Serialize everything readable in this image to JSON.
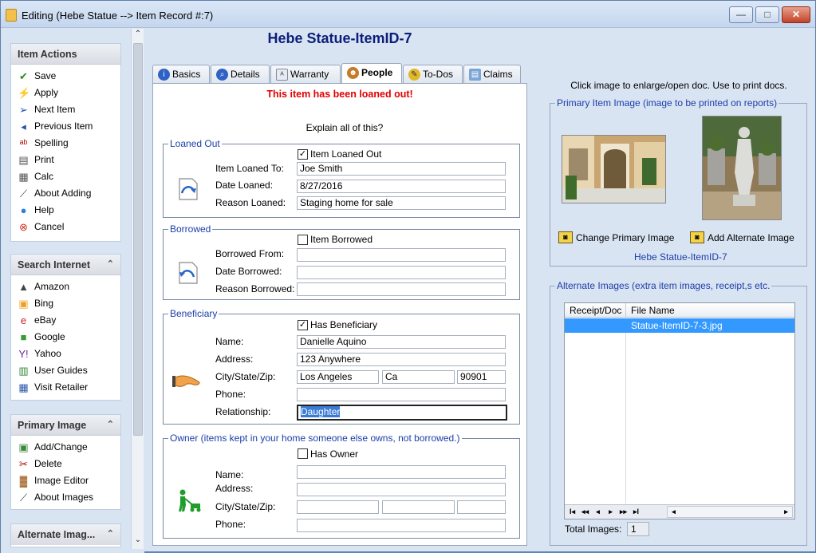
{
  "window": {
    "title": "Editing  (Hebe Statue --> Item Record #:7)",
    "minimize": "—",
    "maximize": "□",
    "close": "✕"
  },
  "sidebar": {
    "item_actions": {
      "header": "Item Actions",
      "items": [
        {
          "label": "Save",
          "icon": "check-icon",
          "glyph": "✔",
          "color": "#2a8a1a"
        },
        {
          "label": "Apply",
          "icon": "apply-icon",
          "glyph": "⚡",
          "color": "#d08a00"
        },
        {
          "label": "Next Item",
          "icon": "next-icon",
          "glyph": "➢",
          "color": "#2855a8"
        },
        {
          "label": "Previous Item",
          "icon": "previous-icon",
          "glyph": "◂",
          "color": "#2855a8"
        },
        {
          "label": "Spelling",
          "icon": "spelling-icon",
          "glyph": "ᵃᵇ",
          "color": "#b00000"
        },
        {
          "label": "Print",
          "icon": "printer-icon",
          "glyph": "▤",
          "color": "#555"
        },
        {
          "label": "Calc",
          "icon": "calculator-icon",
          "glyph": "▦",
          "color": "#555"
        },
        {
          "label": "About Adding",
          "icon": "wand-icon",
          "glyph": "⟋",
          "color": "#444"
        },
        {
          "label": "Help",
          "icon": "help-icon",
          "glyph": "●",
          "color": "#2f7fd8"
        },
        {
          "label": "Cancel",
          "icon": "cancel-icon",
          "glyph": "⊗",
          "color": "#d62d20"
        }
      ]
    },
    "search_internet": {
      "header": "Search Internet",
      "collapse": "⌃",
      "items": [
        {
          "label": "Amazon",
          "icon": "amazon-icon",
          "glyph": "▲",
          "color": "#444"
        },
        {
          "label": "Bing",
          "icon": "bing-icon",
          "glyph": "▣",
          "color": "#f0a020"
        },
        {
          "label": "eBay",
          "icon": "ebay-icon",
          "glyph": "e",
          "color": "#c0232c"
        },
        {
          "label": "Google",
          "icon": "google-icon",
          "glyph": "■",
          "color": "#3a9a3a"
        },
        {
          "label": "Yahoo",
          "icon": "yahoo-icon",
          "glyph": "Y!",
          "color": "#6b1fa8"
        },
        {
          "label": "User Guides",
          "icon": "guides-icon",
          "glyph": "▥",
          "color": "#3a8a3a"
        },
        {
          "label": "Visit Retailer",
          "icon": "retailer-icon",
          "glyph": "▦",
          "color": "#2855a8"
        }
      ]
    },
    "primary_image": {
      "header": "Primary Image",
      "collapse": "⌃",
      "items": [
        {
          "label": "Add/Change",
          "icon": "add-image-icon",
          "glyph": "▣",
          "color": "#3a8a3a"
        },
        {
          "label": "Delete",
          "icon": "delete-icon",
          "glyph": "✂",
          "color": "#b00000"
        },
        {
          "label": "Image Editor",
          "icon": "image-editor-icon",
          "glyph": "▓",
          "color": "#a06020"
        },
        {
          "label": "About Images",
          "icon": "wand-icon",
          "glyph": "⟋",
          "color": "#444"
        }
      ]
    },
    "alternate_images": {
      "header": "Alternate Imag...",
      "collapse": "⌃"
    },
    "scroll_up": "⌃",
    "scroll_down": "⌄"
  },
  "main": {
    "heading": "Hebe Statue-ItemID-7",
    "tabs": [
      {
        "label": "Basics",
        "icon": "info-icon",
        "active": false
      },
      {
        "label": "Details",
        "icon": "magnifier-icon",
        "active": false
      },
      {
        "label": "Warranty",
        "icon": "warranty-icon",
        "active": false
      },
      {
        "label": "People",
        "icon": "people-icon",
        "active": true
      },
      {
        "label": "To-Dos",
        "icon": "todo-icon",
        "active": false
      },
      {
        "label": "Claims",
        "icon": "claims-icon",
        "active": false
      }
    ],
    "loaned_message": "This item has been loaned out!",
    "explain": "Explain all of this?",
    "loaned_out": {
      "legend": "Loaned Out",
      "checkbox_label": "Item Loaned Out",
      "checked": true,
      "fields": [
        {
          "label": "Item Loaned To:",
          "value": "Joe Smith"
        },
        {
          "label": "Date Loaned:",
          "value": "8/27/2016"
        },
        {
          "label": "Reason Loaned:",
          "value": "Staging home for sale"
        }
      ]
    },
    "borrowed": {
      "legend": "Borrowed",
      "checkbox_label": "Item Borrowed",
      "checked": false,
      "fields": [
        {
          "label": "Borrowed From:",
          "value": ""
        },
        {
          "label": "Date Borrowed:",
          "value": ""
        },
        {
          "label": "Reason Borrowed:",
          "value": ""
        }
      ]
    },
    "beneficiary": {
      "legend": "Beneficiary",
      "checkbox_label": "Has Beneficiary",
      "checked": true,
      "name_label": "Name:",
      "name": "Danielle Aquino",
      "address_label": "Address:",
      "address": "123 Anywhere",
      "csz_label": "City/State/Zip:",
      "city": "Los Angeles",
      "state": "Ca",
      "zip": "90901",
      "phone_label": "Phone:",
      "phone": "",
      "relationship_label": "Relationship:",
      "relationship": "Daughter"
    },
    "owner": {
      "legend": "Owner (items kept in your home someone else owns, not borrowed.)",
      "checkbox_label": "Has Owner",
      "checked": false,
      "name_label": "Name:",
      "name": "",
      "address_label": "Address:",
      "address": "",
      "csz_label": "City/State/Zip:",
      "city": "",
      "state": "",
      "zip": "",
      "phone_label": "Phone:",
      "phone": ""
    }
  },
  "right": {
    "hint": "Click image to enlarge/open doc. Use to print docs.",
    "primary_legend": "Primary Item Image (image to be printed on reports)",
    "change_primary": "Change Primary Image",
    "add_alternate": "Add Alternate Image",
    "image_name": "Hebe Statue-ItemID-7",
    "alt_legend": "Alternate Images (extra item images, receipt,s etc.",
    "grid": {
      "columns": [
        "Receipt/Doc",
        "File Name"
      ],
      "rows": [
        {
          "receipt": "",
          "file": "Statue-ItemID-7-3.jpg"
        }
      ]
    },
    "nav": [
      "I◂",
      "◂◂",
      "◂",
      "▸",
      "▸▸",
      "▸I",
      "◂",
      "▸"
    ],
    "total_label": "Total Images:",
    "total_value": "1"
  }
}
